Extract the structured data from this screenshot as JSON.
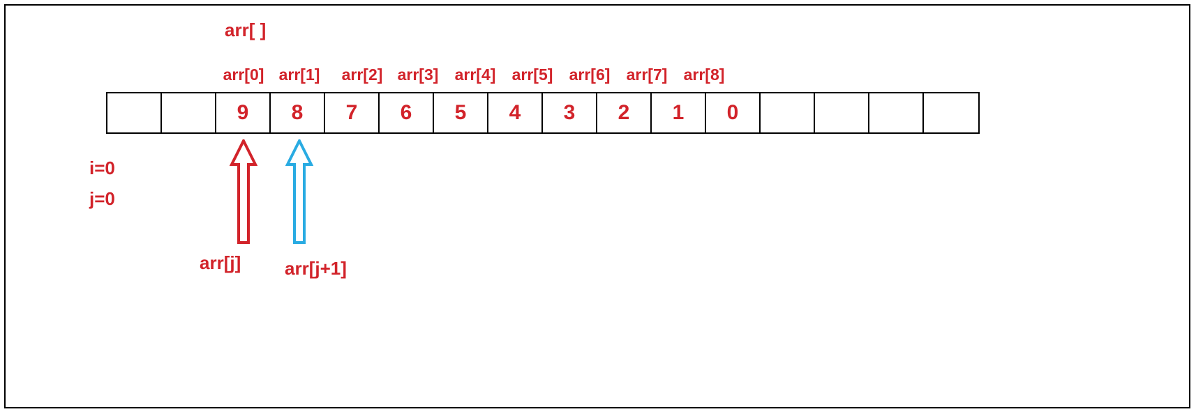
{
  "title": "arr[ ]",
  "index_labels": [
    "arr[0]",
    "arr[1]",
    "arr[2]",
    "arr[3]",
    "arr[4]",
    "arr[5]",
    "arr[6]",
    "arr[7]",
    "arr[8]"
  ],
  "cells": [
    "",
    "",
    "9",
    "8",
    "7",
    "6",
    "5",
    "4",
    "3",
    "2",
    "1",
    "0",
    "",
    "",
    "",
    ""
  ],
  "counter_i": "i=0",
  "counter_j": "j=0",
  "arrow_j_label": "arr[j]",
  "arrow_j1_label": "arr[j+1]",
  "colors": {
    "red": "#d2232a",
    "blue": "#29abe2",
    "black": "#000000"
  }
}
